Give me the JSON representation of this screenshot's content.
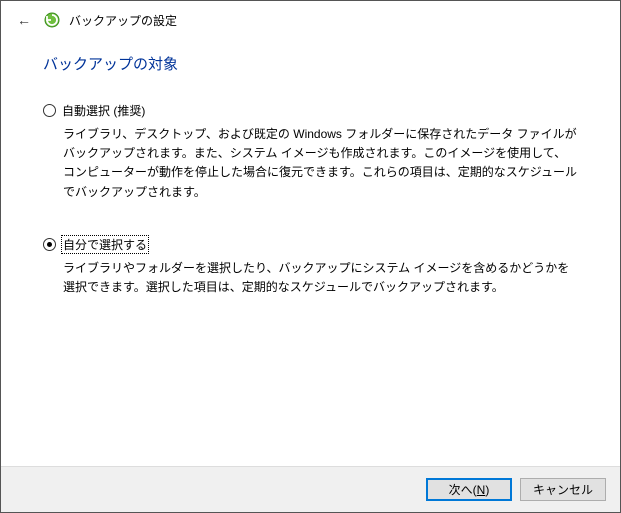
{
  "header": {
    "title": "バックアップの設定"
  },
  "page": {
    "title": "バックアップの対象"
  },
  "options": {
    "auto": {
      "label": "自動選択 (推奨)",
      "desc": "ライブラリ、デスクトップ、および既定の Windows フォルダーに保存されたデータ ファイルがバックアップされます。また、システム イメージも作成されます。このイメージを使用して、コンピューターが動作を停止した場合に復元できます。これらの項目は、定期的なスケジュールでバックアップされます。",
      "selected": false
    },
    "manual": {
      "label": "自分で選択する",
      "desc": "ライブラリやフォルダーを選択したり、バックアップにシステム イメージを含めるかどうかを選択できます。選択した項目は、定期的なスケジュールでバックアップされます。",
      "selected": true
    }
  },
  "footer": {
    "next_prefix": "次へ(",
    "next_key": "N",
    "next_suffix": ")",
    "cancel": "キャンセル"
  }
}
